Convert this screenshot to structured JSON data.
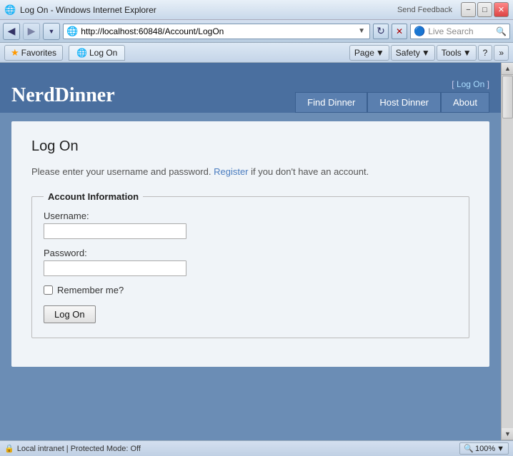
{
  "title_bar": {
    "title": "Log On - Windows Internet Explorer",
    "send_feedback": "Send Feedback",
    "minimize": "−",
    "maximize": "□",
    "close": "✕"
  },
  "address_bar": {
    "url": "http://localhost:60848/Account/LogOn",
    "live_search_placeholder": "Live Search"
  },
  "favorites_bar": {
    "favorites_label": "Favorites",
    "tab_label": "Log On",
    "page_label": "Page",
    "safety_label": "Safety",
    "tools_label": "Tools"
  },
  "header": {
    "logo": "NerdDinner",
    "logon_text": "[ ",
    "logon_link": "Log On",
    "logon_text_end": " ]",
    "nav": [
      {
        "label": "Find Dinner"
      },
      {
        "label": "Host Dinner"
      },
      {
        "label": "About"
      }
    ]
  },
  "main": {
    "page_title": "Log On",
    "description": "Please enter your username and password. ",
    "register_link": "Register",
    "description_end": " if you don't have an account.",
    "fieldset_legend": "Account Information",
    "username_label": "Username:",
    "password_label": "Password:",
    "remember_label": "Remember me?",
    "submit_label": "Log On"
  },
  "status_bar": {
    "zone": "Local intranet | Protected Mode: Off",
    "zoom": "100%"
  }
}
